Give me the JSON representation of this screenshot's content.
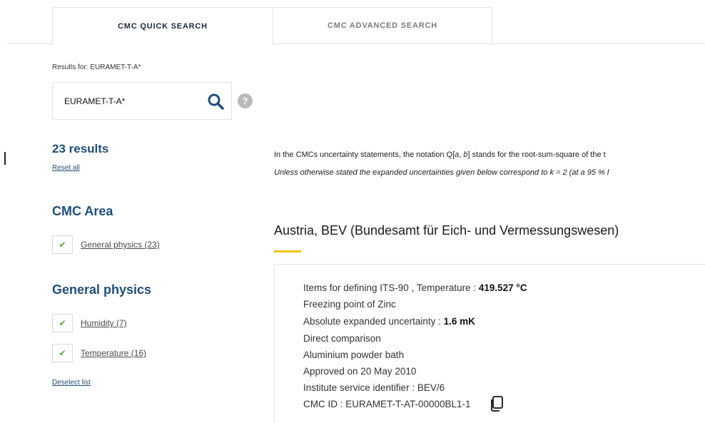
{
  "tabs": {
    "quick": "CMC QUICK SEARCH",
    "advanced": "CMC ADVANCED SEARCH"
  },
  "search": {
    "results_for": "Results for: EURAMET-T-A*",
    "value": "EURAMET-T-A*",
    "help": "?"
  },
  "results": {
    "count": "23 results",
    "reset": "Reset all"
  },
  "facets": {
    "area_title": "CMC Area",
    "area_items": [
      "General physics (23)"
    ],
    "physics_title": "General physics",
    "physics_items": [
      "Humidity (7)",
      "Temperature (16)"
    ],
    "deselect": "Deselect list"
  },
  "notes": {
    "line1_a": "In the CMCs uncertainty statements, the notation Q[",
    "line1_i1": "a",
    "line1_b": ", ",
    "line1_i2": "b",
    "line1_c": "] stands for the root-sum-square of the t",
    "line2": "Unless otherwise stated the expanded uncertainties given below correspond to k = 2 (at a 95 % l"
  },
  "result": {
    "institute": "Austria, BEV (Bundesamt für Eich- und Vermessungswesen)",
    "items_label": "Items for defining ITS-90 , Temperature : ",
    "items_value": "419.527 °C",
    "point": "Freezing point of Zinc",
    "uncertainty_label": "Absolute expanded uncertainty : ",
    "uncertainty_value": "1.6 mK",
    "method": "Direct comparison",
    "apparatus": "Aluminium powder bath",
    "approved": "Approved on 20 May 2010",
    "service_id": "Institute service identifier : BEV/6",
    "cmc_id": "CMC ID : EURAMET-T-AT-00000BL1-1"
  },
  "colors": {
    "accent": "#1f4e79",
    "check": "#5aa832",
    "underline": "#f2c100"
  }
}
